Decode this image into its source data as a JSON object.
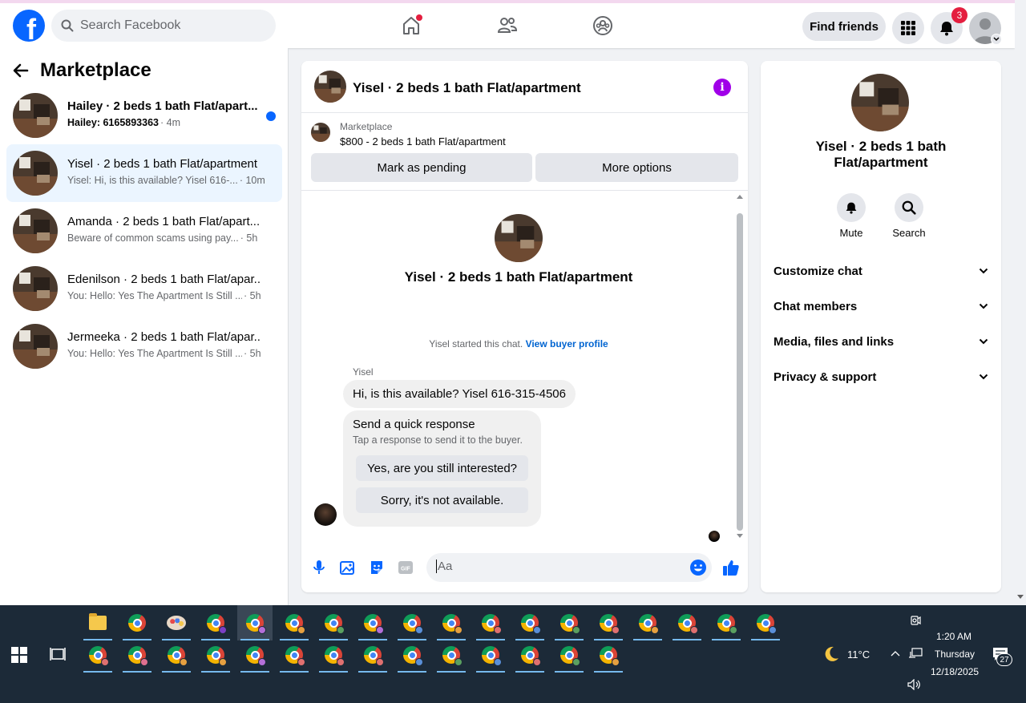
{
  "topbar": {
    "search_placeholder": "Search Facebook",
    "find_friends_label": "Find friends",
    "notification_count": "3"
  },
  "sidebar": {
    "title": "Marketplace",
    "conversations": [
      {
        "name": "Hailey · 2 beds 1 bath Flat/apart...",
        "message": "Hailey: 6165893363",
        "time": "· 4m",
        "unread": true
      },
      {
        "name": "Yisel · 2 beds 1 bath Flat/apartment",
        "message": "Yisel: Hi, is this available? Yisel 616-...",
        "time": "· 10m",
        "unread": false
      },
      {
        "name": "Amanda · 2 beds 1 bath Flat/apart...",
        "message": "Beware of common scams using pay...",
        "time": "· 5h",
        "unread": false
      },
      {
        "name": "Edenilson · 2 beds 1 bath Flat/apar...",
        "message": "You: Hello: Yes The Apartment Is Still ...",
        "time": "· 5h",
        "unread": false
      },
      {
        "name": "Jermeeka · 2 beds 1 bath Flat/apar...",
        "message": "You: Hello: Yes The Apartment Is Still ...",
        "time": "· 5h",
        "unread": false
      }
    ]
  },
  "chat": {
    "header_title": "Yisel · 2 beds 1 bath Flat/apartment",
    "listing_source": "Marketplace",
    "listing_title": "$800 - 2 beds 1 bath Flat/apartment",
    "mark_pending_label": "Mark as pending",
    "more_options_label": "More options",
    "thread_title": "Yisel · 2 beds 1 bath Flat/apartment",
    "started_text": "Yisel started this chat.",
    "view_profile_label": "View buyer profile",
    "sender_name": "Yisel",
    "message_text": "Hi, is this available? Yisel 616-315-4506",
    "quick_title": "Send a quick response",
    "quick_subtitle": "Tap a response to send it to the buyer.",
    "quick_reply_1": "Yes, are you still interested?",
    "quick_reply_2": "Sorry, it's not available.",
    "input_placeholder": "Aa"
  },
  "info_panel": {
    "title": "Yisel · 2 beds 1 bath Flat/apartment",
    "mute_label": "Mute",
    "search_label": "Search",
    "sections": [
      "Customize chat",
      "Chat members",
      "Media, files and links",
      "Privacy & support"
    ]
  },
  "taskbar": {
    "temperature": "11°C",
    "time": "1:20 AM",
    "day": "Thursday",
    "date": "12/18/2025",
    "notification_count": "27"
  },
  "colors": {
    "brand": "#0866ff",
    "accent_purple": "#a000e8",
    "taskbar": "#1c2a38"
  }
}
